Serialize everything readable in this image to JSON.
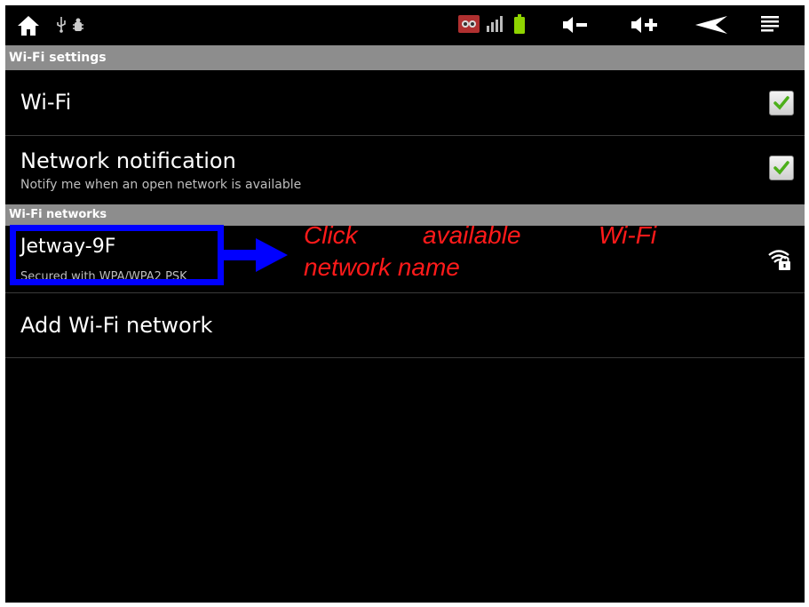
{
  "sections": {
    "wifi_settings": "Wi-Fi settings",
    "wifi_networks": "Wi-Fi networks"
  },
  "wifi_row": {
    "title": "Wi-Fi",
    "checked": true
  },
  "notification_row": {
    "title": "Network notification",
    "subtitle": "Notify me when an open network is available",
    "checked": true
  },
  "network": {
    "name": "Jetway-9F",
    "security": "Secured with WPA/WPA2 PSK"
  },
  "add_network": {
    "label": "Add Wi-Fi network"
  },
  "annotation": {
    "word1": "Click",
    "word2": "available",
    "word3": "Wi-Fi",
    "line2": "network name"
  },
  "status_icons": [
    "home-icon",
    "usb-icon",
    "debug-icon",
    "app-notification-icon",
    "signal-icon",
    "battery-icon",
    "volume-down-icon",
    "volume-up-icon",
    "back-icon",
    "menu-icon"
  ],
  "colors": {
    "section_header": "#8d8d8d",
    "annotation_text": "#ff1a1a",
    "annotation_box": "#0000ff",
    "check": "#4caf1a"
  }
}
